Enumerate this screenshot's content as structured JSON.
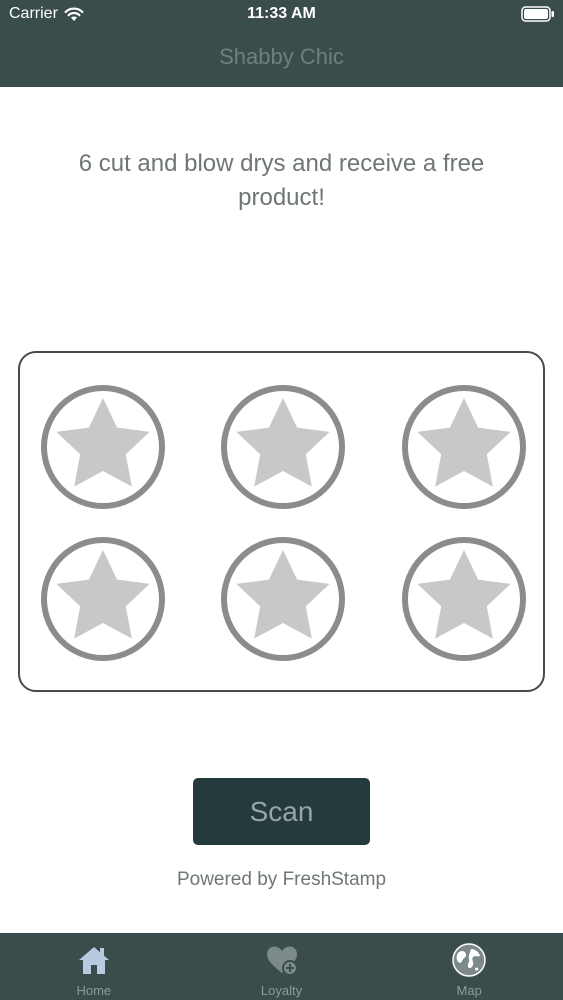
{
  "status_bar": {
    "carrier": "Carrier",
    "time": "11:33 AM"
  },
  "nav": {
    "title": "Shabby Chic"
  },
  "promo": {
    "text": "6 cut and blow drys and receive a free product!"
  },
  "stamp_card": {
    "total_stamps": 6,
    "collected": 0,
    "stamp_icon": "star-icon"
  },
  "scan_button": {
    "label": "Scan"
  },
  "footer": {
    "powered_by": "Powered by FreshStamp"
  },
  "tabs": [
    {
      "label": "Home",
      "icon": "home-icon",
      "selected": true
    },
    {
      "label": "Loyalty",
      "icon": "heart-plus-icon",
      "selected": false
    },
    {
      "label": "Map",
      "icon": "globe-icon",
      "selected": false
    }
  ],
  "colors": {
    "header_bg": "#3b4c4c",
    "title_text": "#6f7f80",
    "button_bg": "#253a3d",
    "button_text": "#97a5a6",
    "stamp_ring": "#8c8c8c",
    "stamp_star": "#c9c8c9",
    "tab_icon_selected": "#b7cae0",
    "tab_icon": "#7d8a8b"
  }
}
